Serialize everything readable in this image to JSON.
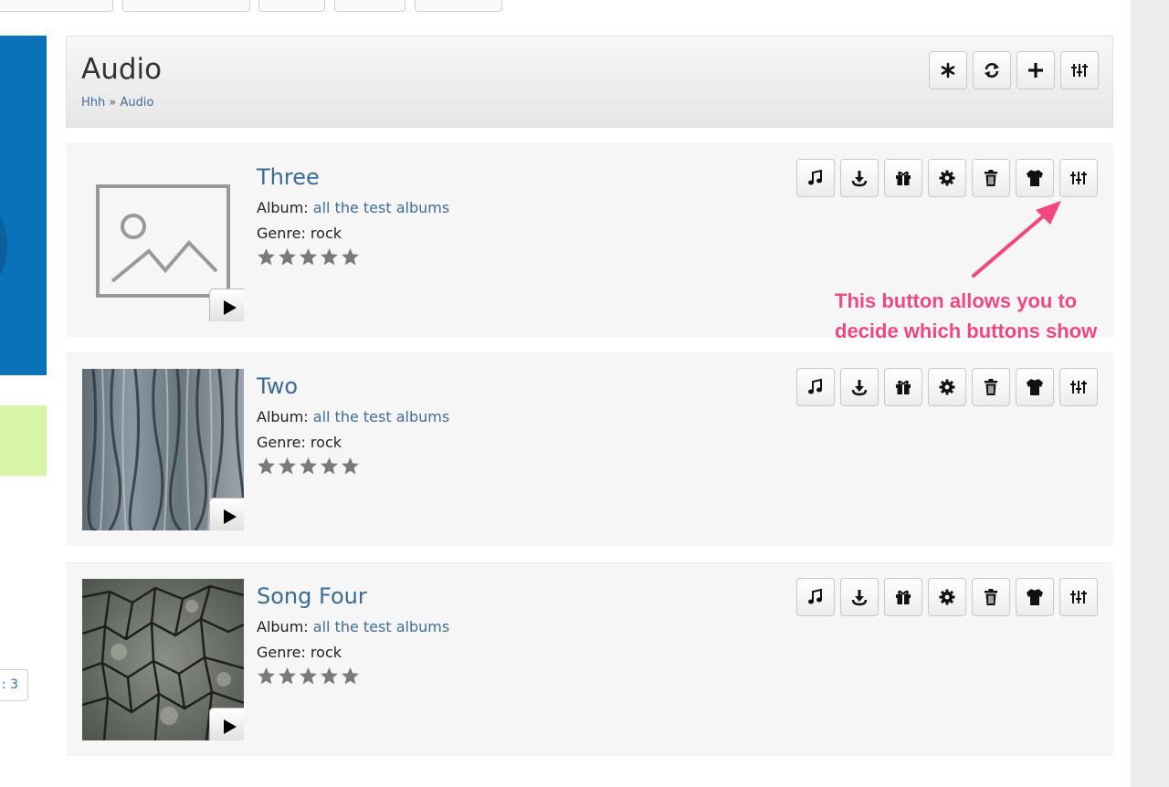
{
  "header": {
    "title": "Audio",
    "breadcrumb": {
      "root": "Hhh",
      "separator": "»",
      "current": "Audio"
    },
    "actions": [
      {
        "icon": "asterisk-icon"
      },
      {
        "icon": "refresh-icon"
      },
      {
        "icon": "plus-icon"
      },
      {
        "icon": "sliders-icon"
      }
    ]
  },
  "sidebar": {
    "page_indicator": ": 3"
  },
  "items": [
    {
      "title": "Three",
      "album_label": "Album:",
      "album": "all the test albums",
      "genre": "Genre: rock",
      "rating": 5,
      "thumbnail": "placeholder-image"
    },
    {
      "title": "Two",
      "album_label": "Album:",
      "album": "all the test albums",
      "genre": "Genre: rock",
      "rating": 5,
      "thumbnail": "bark-texture"
    },
    {
      "title": "Song Four",
      "album_label": "Album:",
      "album": "all the test albums",
      "genre": "Genre: rock",
      "rating": 5,
      "thumbnail": "cracked-bark-texture"
    }
  ],
  "item_actions": [
    "music-icon",
    "download-icon",
    "gift-icon",
    "gear-icon",
    "trash-icon",
    "shirt-icon",
    "sliders-icon"
  ],
  "annotation": {
    "line1": "This button allows you to",
    "line2": "decide which buttons show",
    "color": "#f2467e"
  },
  "colors": {
    "link": "#3f6d9a",
    "accent_blue": "#0a72b9",
    "accent_green": "#d7f5a6"
  }
}
